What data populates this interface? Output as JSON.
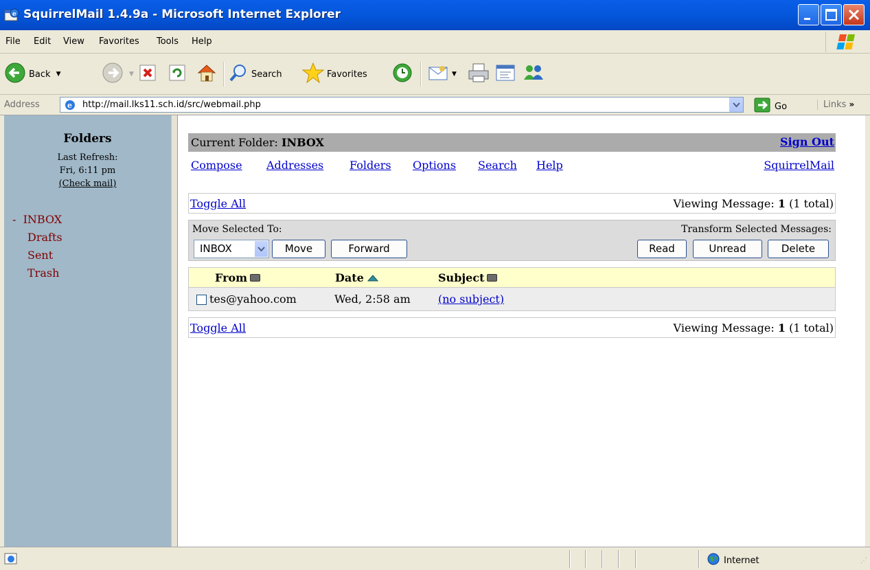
{
  "window": {
    "title": "SquirrelMail 1.4.9a - Microsoft Internet Explorer"
  },
  "menu": [
    "File",
    "Edit",
    "View",
    "Favorites",
    "Tools",
    "Help"
  ],
  "toolbar": {
    "back": "Back",
    "search": "Search",
    "favorites": "Favorites"
  },
  "address": {
    "label": "Address",
    "url": "http://mail.lks11.sch.id/src/webmail.php",
    "go": "Go",
    "links": "Links"
  },
  "left_frame": {
    "title": "Folders",
    "last_refresh_label": "Last Refresh:",
    "last_refresh_time": "Fri, 6:11 pm",
    "check_mail": "(Check mail)",
    "current_marker": "-",
    "folders": [
      "INBOX",
      "Drafts",
      "Sent",
      "Trash"
    ]
  },
  "header": {
    "current_folder_label": "Current Folder:",
    "current_folder": "INBOX",
    "sign_out": "Sign Out",
    "nav": [
      "Compose",
      "Addresses",
      "Folders",
      "Options",
      "Search",
      "Help"
    ],
    "brand_link": "SquirrelMail"
  },
  "list": {
    "toggle_all": "Toggle All",
    "viewing_prefix": "Viewing Message:",
    "viewing_num": "1",
    "viewing_suffix": "(1 total)",
    "move_selected_label": "Move Selected To:",
    "transform_label": "Transform Selected Messages:",
    "move_target": "INBOX",
    "buttons": {
      "move": "Move",
      "forward": "Forward",
      "read": "Read",
      "unread": "Unread",
      "delete": "Delete"
    },
    "columns": {
      "from": "From",
      "date": "Date",
      "subject": "Subject"
    },
    "messages": [
      {
        "from": "tes@yahoo.com",
        "date": "Wed, 2:58 am",
        "subject": "(no subject)"
      }
    ]
  },
  "status": {
    "zone": "Internet"
  },
  "colors": {
    "title_blue": "#0455D9",
    "left_frame_bg": "#A0B8C8",
    "folder_text": "#800000",
    "link": "#0000CC",
    "header_gray": "#ABABAB",
    "table_header": "#FFFFCC"
  }
}
